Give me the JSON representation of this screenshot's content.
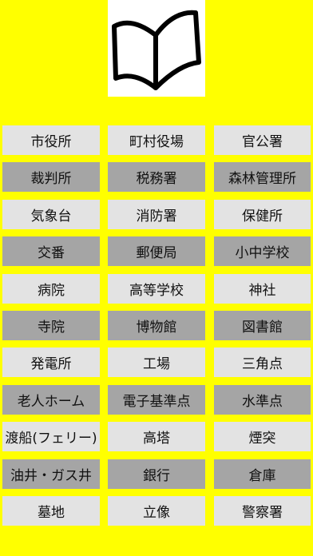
{
  "app": {
    "logo_icon": "open-book-icon"
  },
  "colors": {
    "background": "#ffff00",
    "button_light": "#e3e3e3",
    "button_dark": "#a5a5a5",
    "text": "#111111"
  },
  "rows": [
    [
      "市役所",
      "町村役場",
      "官公署"
    ],
    [
      "裁判所",
      "税務署",
      "森林管理所"
    ],
    [
      "気象台",
      "消防署",
      "保健所"
    ],
    [
      "交番",
      "郵便局",
      "小中学校"
    ],
    [
      "病院",
      "高等学校",
      "神社"
    ],
    [
      "寺院",
      "博物館",
      "図書館"
    ],
    [
      "発電所",
      "工場",
      "三角点"
    ],
    [
      "老人ホーム",
      "電子基準点",
      "水準点"
    ],
    [
      "渡船(フェリー)",
      "高塔",
      "煙突"
    ],
    [
      "油井・ガス井",
      "銀行",
      "倉庫"
    ],
    [
      "墓地",
      "立像",
      "警察署"
    ]
  ]
}
